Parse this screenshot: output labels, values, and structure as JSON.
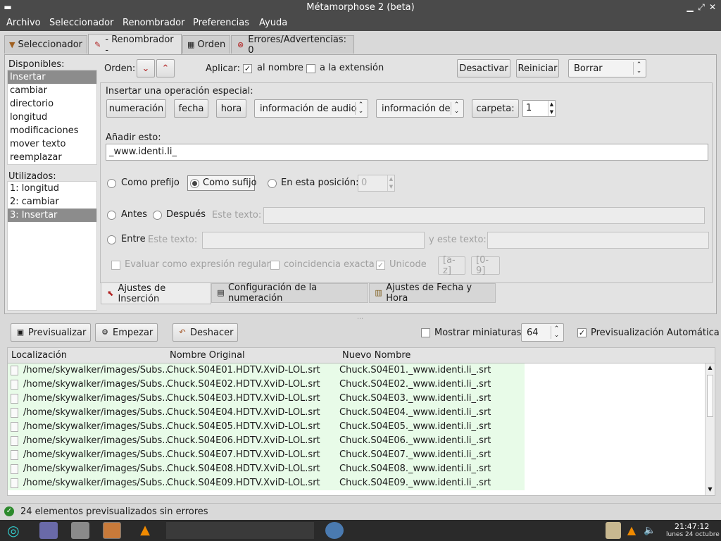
{
  "window": {
    "title": "Métamorphose 2 (beta)"
  },
  "menu": [
    "Archivo",
    "Seleccionador",
    "Renombrador",
    "Preferencias",
    "Ayuda"
  ],
  "tabs": [
    {
      "label": "Seleccionador",
      "icon": "funnel-icon"
    },
    {
      "label": "- Renombrador -",
      "icon": "rename-icon"
    },
    {
      "label": "Orden",
      "icon": "grid-icon"
    },
    {
      "label": "Errores/Advertencias: 0",
      "icon": "error-icon"
    }
  ],
  "available": {
    "label": "Disponibles:",
    "items": [
      "Insertar",
      "cambiar",
      "directorio",
      "longitud",
      "modificaciones",
      "mover texto",
      "reemplazar"
    ],
    "selected_index": 0
  },
  "used": {
    "label": "Utilizados:",
    "items": [
      "1: longitud",
      "2: cambiar",
      "3: Insertar"
    ],
    "selected_index": 2
  },
  "top": {
    "order_label": "Orden:",
    "apply_label": "Aplicar:",
    "to_name": "al nombre",
    "to_name_checked": true,
    "to_extension": "a la extensión",
    "to_extension_checked": false,
    "deactivate": "Desactivar",
    "reset": "Reiniciar",
    "delete_select": "Borrar"
  },
  "special": {
    "label": "Insertar una operación especial:",
    "numbering": "numeración",
    "date": "fecha",
    "time": "hora",
    "audio_select": "información de audio",
    "info_select": "información de",
    "folder": "carpeta:",
    "folder_value": "1"
  },
  "add": {
    "label": "Añadir esto:",
    "value": "_www.identi.li_"
  },
  "position": {
    "prefix": "Como prefijo",
    "suffix": "Como sufijo",
    "at_position": "En esta posición:",
    "position_value": "0",
    "selected": "suffix"
  },
  "before_after": {
    "before": "Antes",
    "after": "Después",
    "text_label": "Este texto:"
  },
  "between": {
    "between": "Entre",
    "text_label": "Este texto:",
    "and_text_label": "y este texto:"
  },
  "options": {
    "regex": "Evaluar como expresión regular",
    "exact": "coincidencia exacta",
    "unicode": "Unicode",
    "unicode_checked": true,
    "az": "[a-z]",
    "digits": "[0-9]"
  },
  "subtabs": [
    "Ajustes de Inserción",
    "Configuración de la numeración",
    "Ajustes de Fecha y Hora"
  ],
  "toolbar": {
    "preview": "Previsualizar",
    "start": "Empezar",
    "undo": "Deshacer",
    "thumbnails": "Mostrar miniaturas",
    "thumbnails_checked": false,
    "thumb_size": "64",
    "auto_preview": "Previsualización Automática",
    "auto_preview_checked": true
  },
  "table": {
    "columns": [
      "Localización",
      "Nombre Original",
      "Nuevo Nombre"
    ],
    "rows": [
      [
        "/home/skywalker/images/Subs...",
        "Chuck.S04E01.HDTV.XviD-LOL.srt",
        "Chuck.S04E01._www.identi.li_.srt"
      ],
      [
        "/home/skywalker/images/Subs...",
        "Chuck.S04E02.HDTV.XviD-LOL.srt",
        "Chuck.S04E02._www.identi.li_.srt"
      ],
      [
        "/home/skywalker/images/Subs...",
        "Chuck.S04E03.HDTV.XviD-LOL.srt",
        "Chuck.S04E03._www.identi.li_.srt"
      ],
      [
        "/home/skywalker/images/Subs...",
        "Chuck.S04E04.HDTV.XviD-LOL.srt",
        "Chuck.S04E04._www.identi.li_.srt"
      ],
      [
        "/home/skywalker/images/Subs...",
        "Chuck.S04E05.HDTV.XviD-LOL.srt",
        "Chuck.S04E05._www.identi.li_.srt"
      ],
      [
        "/home/skywalker/images/Subs...",
        "Chuck.S04E06.HDTV.XviD-LOL.srt",
        "Chuck.S04E06._www.identi.li_.srt"
      ],
      [
        "/home/skywalker/images/Subs...",
        "Chuck.S04E07.HDTV.XviD-LOL.srt",
        "Chuck.S04E07._www.identi.li_.srt"
      ],
      [
        "/home/skywalker/images/Subs...",
        "Chuck.S04E08.HDTV.XviD-LOL.srt",
        "Chuck.S04E08._www.identi.li_.srt"
      ],
      [
        "/home/skywalker/images/Subs...",
        "Chuck.S04E09.HDTV.XviD-LOL.srt",
        "Chuck.S04E09._www.identi.li_.srt"
      ]
    ]
  },
  "status": {
    "text": "24 elementos previsualizados sin errores"
  },
  "taskbar": {
    "time": "21:47:12",
    "date": "lunes 24 octubre"
  },
  "colors": {
    "new_name_bg": "#e8fbe8",
    "selection": "#8c8c8c",
    "titlebar": "#4a4a4a"
  }
}
